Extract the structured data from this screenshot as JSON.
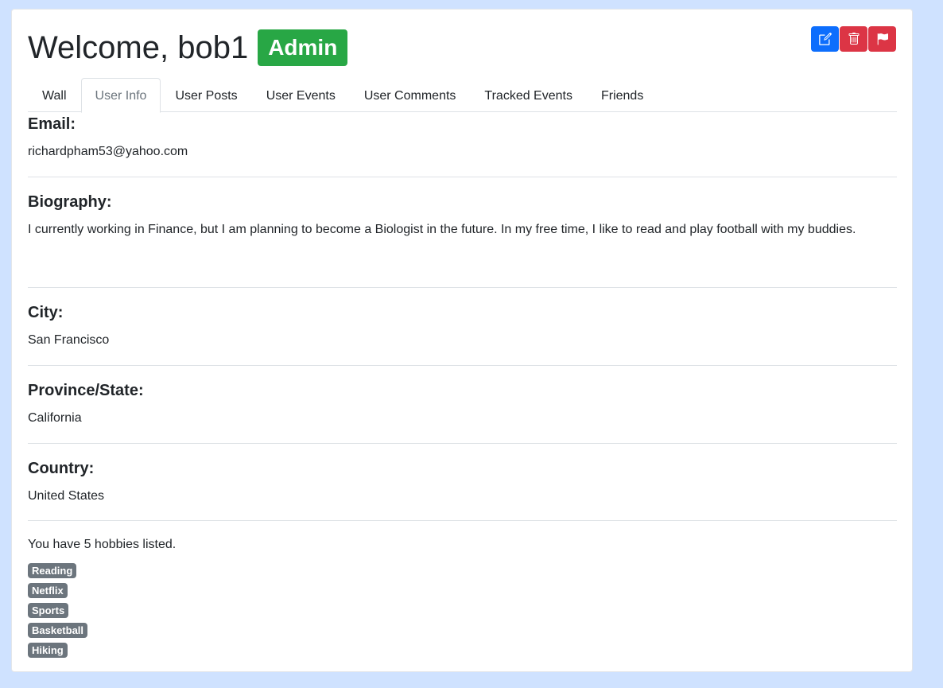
{
  "header": {
    "welcome": "Welcome, bob1",
    "role_badge": "Admin"
  },
  "actions": {
    "edit_icon": "pencil-square-icon",
    "delete_icon": "trash-icon",
    "flag_icon": "flag-icon",
    "colors": {
      "edit": "#0d6efd",
      "delete": "#dc3545",
      "flag": "#dc3545"
    }
  },
  "tabs": [
    {
      "label": "Wall"
    },
    {
      "label": "User Info",
      "active": true
    },
    {
      "label": "User Posts"
    },
    {
      "label": "User Events"
    },
    {
      "label": "User Comments"
    },
    {
      "label": "Tracked Events"
    },
    {
      "label": "Friends"
    }
  ],
  "info": {
    "email_label": "Email:",
    "email": "richardpham53@yahoo.com",
    "bio_label": "Biography:",
    "bio": "I currently working in Finance, but I am planning to become a Biologist in the future. In my free time, I like to read and play football with my buddies.",
    "city_label": "City:",
    "city": "San Francisco",
    "province_label": "Province/State:",
    "province": "California",
    "country_label": "Country:",
    "country": "United States"
  },
  "hobbies": {
    "summary": "You have 5 hobbies listed.",
    "items": [
      "Reading",
      "Netflix",
      "Sports",
      "Basketball",
      "Hiking"
    ]
  }
}
